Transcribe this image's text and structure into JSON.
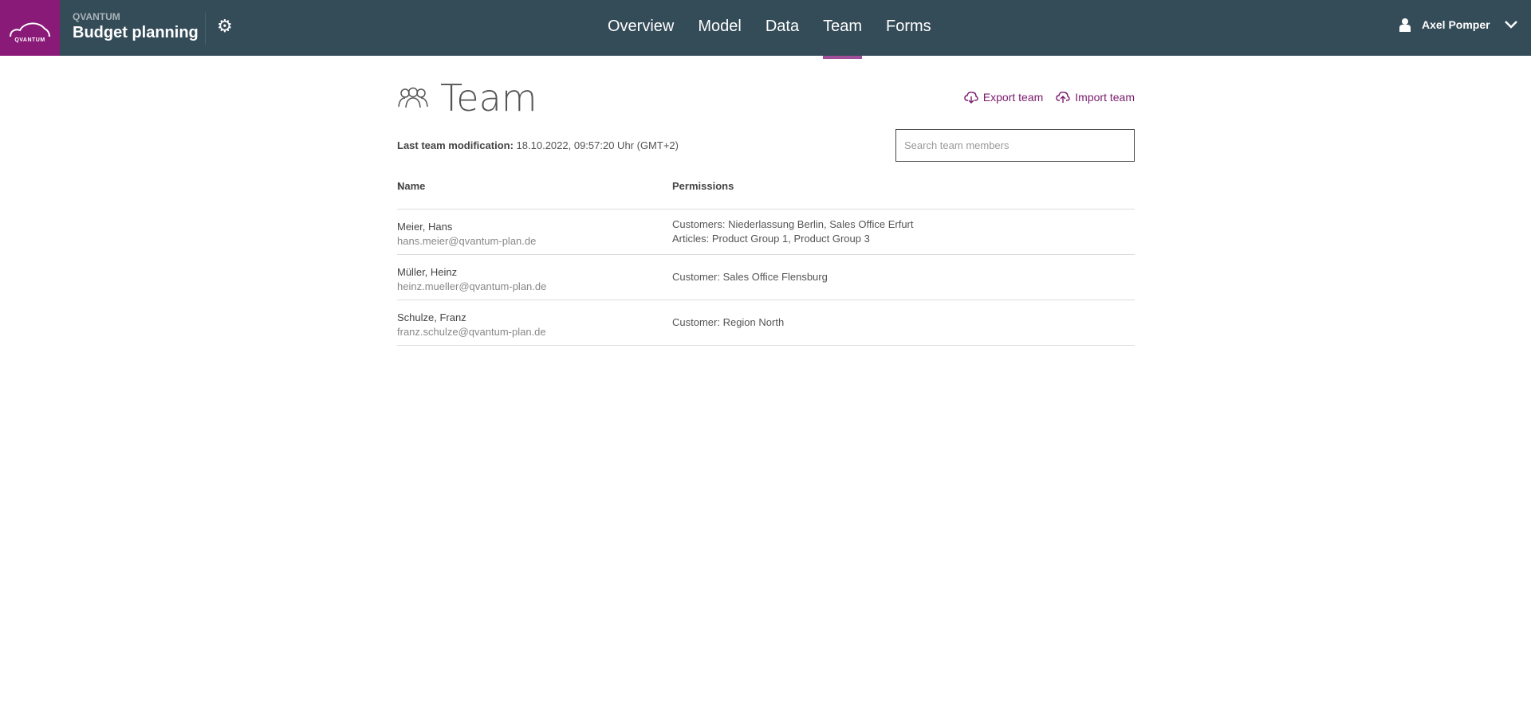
{
  "header": {
    "logo_text": "QVANTUM",
    "app_label": "QVANTUM",
    "app_title": "Budget planning",
    "nav": [
      {
        "label": "Overview"
      },
      {
        "label": "Model"
      },
      {
        "label": "Data"
      },
      {
        "label": "Team",
        "active": true
      },
      {
        "label": "Forms"
      }
    ],
    "user": "Axel Pomper"
  },
  "page": {
    "title": "Team",
    "export": "Export team",
    "import": "Import team",
    "mod_label": "Last team modification:",
    "mod_value": "18.10.2022, 09:57:20 Uhr (GMT+2)",
    "search_placeholder": "Search team members"
  },
  "table": {
    "col_name": "Name",
    "sort_icon": "↑",
    "col_perm": "Permissions",
    "rows": [
      {
        "name": "Meier, Hans",
        "email": "hans.meier@qvantum-plan.de",
        "perms": [
          "Customers: Niederlassung Berlin, Sales Office Erfurt",
          "Articles: Product Group 1, Product Group 3"
        ]
      },
      {
        "name": "Müller, Heinz",
        "email": "heinz.mueller@qvantum-plan.de",
        "perms": [
          "Customer: Sales Office Flensburg"
        ]
      },
      {
        "name": "Schulze, Franz",
        "email": "franz.schulze@qvantum-plan.de",
        "perms": [
          "Customer: Region North"
        ]
      }
    ]
  },
  "colors": {
    "header": "#344b58",
    "brand": "#8a1a78",
    "accent": "#7a1a6c"
  }
}
